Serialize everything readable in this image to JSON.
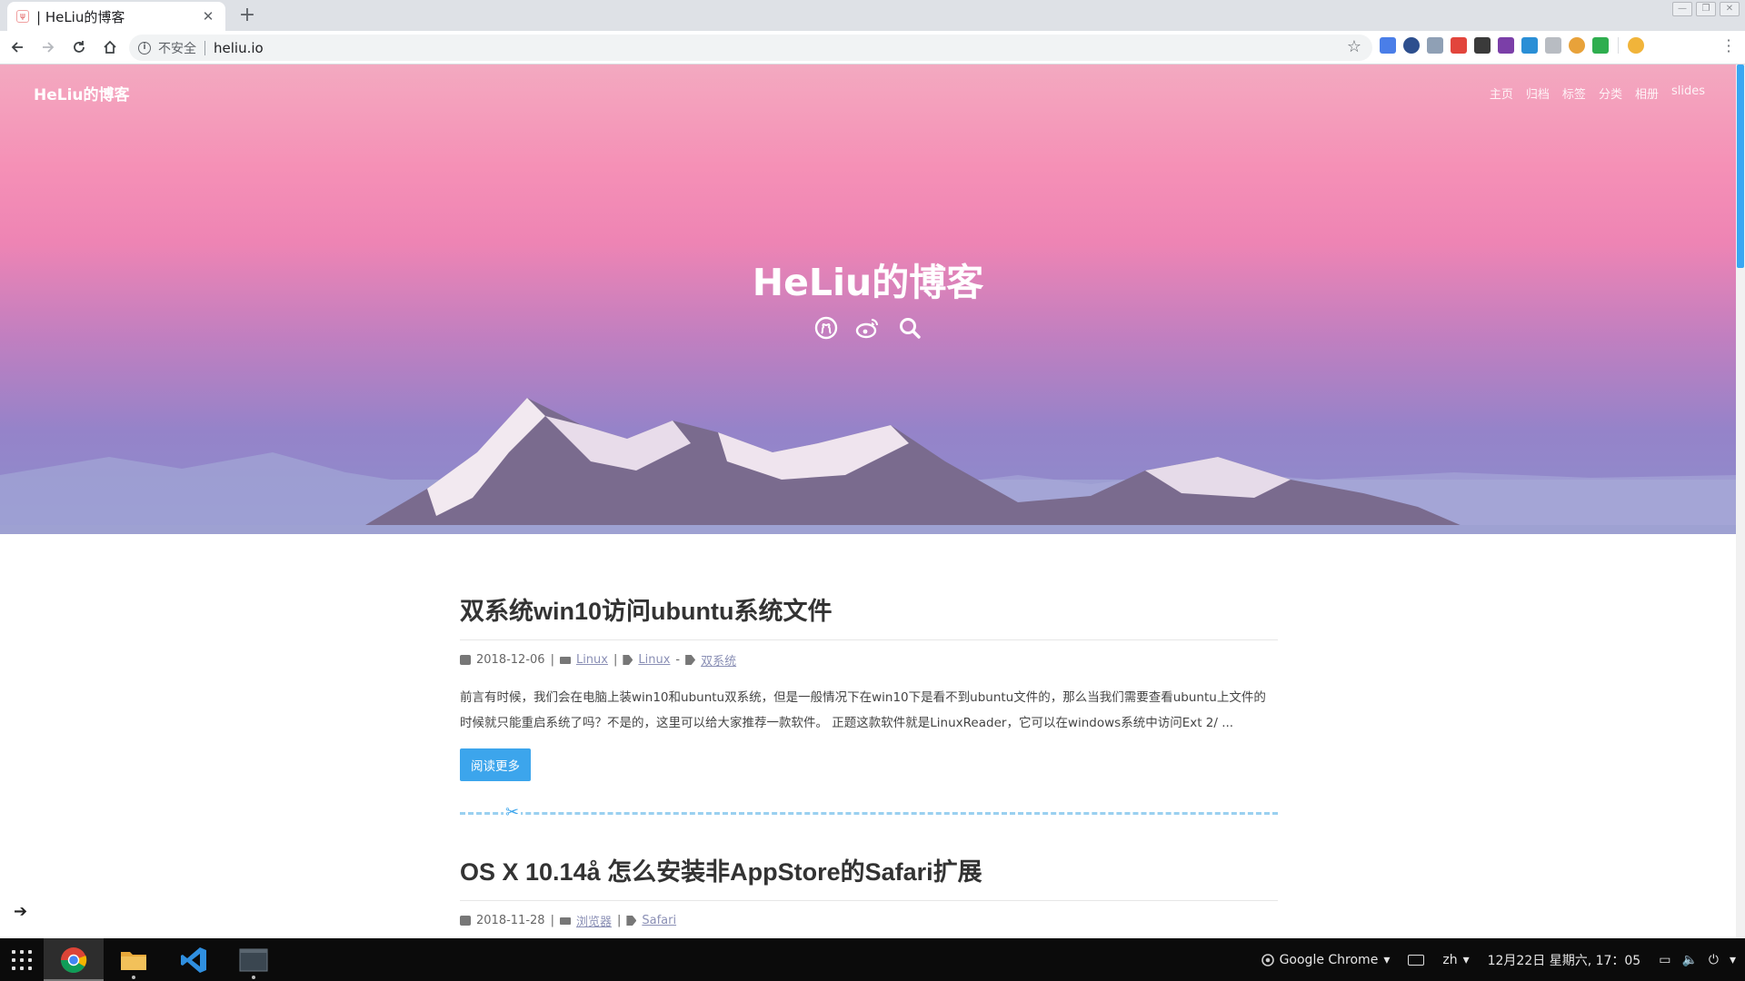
{
  "browser": {
    "tab_title": "| HeLiu的博客",
    "tab_close": "✕",
    "new_tab": "+",
    "security_label": "不安全",
    "url": "heliu.io"
  },
  "site": {
    "brand": "HeLiu的博客",
    "nav": [
      "主页",
      "归档",
      "标签",
      "分类",
      "相册",
      "slides"
    ],
    "hero_title": "HeLiu的博客",
    "hero_icons": [
      "github-icon",
      "weibo-icon",
      "search-icon"
    ]
  },
  "posts": [
    {
      "title": "双系统win10访问ubuntu系统文件",
      "date": "2018-12-06",
      "category": "Linux",
      "tags": [
        "Linux",
        "双系统"
      ],
      "excerpt": "前言有时候，我们会在电脑上装win10和ubuntu双系统，但是一般情况下在win10下是看不到ubuntu文件的，那么当我们需要查看ubuntu上文件的时候就只能重启系统了吗？不是的，这里可以给大家推荐一款软件。 正题这款软件就是LinuxReader，它可以在windows系统中访问Ext 2/ ...",
      "read_more": "阅读更多"
    },
    {
      "title": "OS X 10.14å 怎么安装非AppStore的Safari扩展",
      "date": "2018-11-28",
      "category": "浏览器",
      "tags": [
        "Safari"
      ]
    }
  ],
  "taskbar": {
    "tray_app": "Google Chrome",
    "lang": "zh",
    "datetime": "12月22日 星期六, 17：05"
  },
  "colors": {
    "accent": "#3ca5ec",
    "hero_top": "#f3a9c0",
    "hero_bottom": "#8e8fcc"
  }
}
